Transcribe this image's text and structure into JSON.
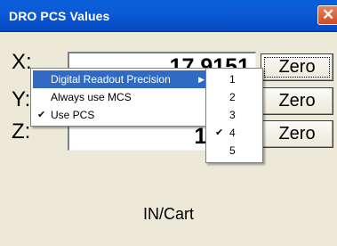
{
  "window": {
    "title": "DRO PCS Values",
    "close_glyph": "✕"
  },
  "axes": [
    {
      "label": "X:",
      "value": "17.9151",
      "zero_label": "Zero"
    },
    {
      "label": "Y:",
      "value": "",
      "zero_label": "Zero"
    },
    {
      "label": "Z:",
      "value": "15.16",
      "zero_label": "Zero"
    }
  ],
  "mode_label": "IN/Cart",
  "context_menu": {
    "items": [
      {
        "label": "Digital Readout Precision",
        "checked": false,
        "has_submenu": true,
        "highlighted": true
      },
      {
        "label": "Always use MCS",
        "checked": false,
        "has_submenu": false,
        "highlighted": false
      },
      {
        "label": "Use PCS",
        "checked": true,
        "has_submenu": false,
        "highlighted": false
      }
    ],
    "check_glyph": "✔",
    "arrow_glyph": "▶"
  },
  "precision_submenu": {
    "items": [
      "1",
      "2",
      "3",
      "4",
      "5"
    ],
    "selected": "4"
  }
}
